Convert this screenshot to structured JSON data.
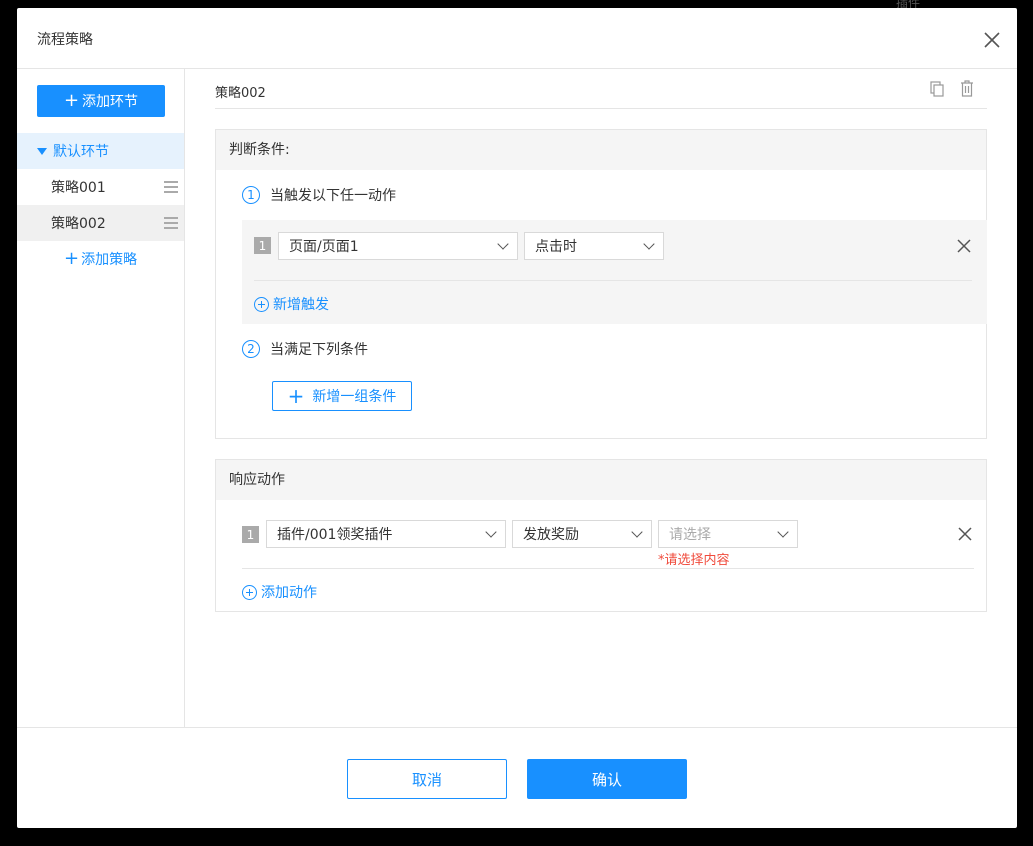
{
  "background_hint": "插件",
  "modal": {
    "title": "流程策略"
  },
  "sidebar": {
    "add_link_label": "添加环节",
    "group_label": "默认环节",
    "policies": [
      {
        "label": "策略001"
      },
      {
        "label": "策略002"
      }
    ],
    "add_policy_label": "添加策略"
  },
  "policy": {
    "name": "策略002"
  },
  "condition_panel": {
    "title": "判断条件:",
    "step1": {
      "num": "1",
      "label": "当触发以下任一动作"
    },
    "triggers": [
      {
        "index": "1",
        "page": "页面/页面1",
        "event": "点击时"
      }
    ],
    "add_trigger_label": "新增触发",
    "step2": {
      "num": "2",
      "label": "当满足下列条件"
    },
    "add_condition_group_label": "新增一组条件"
  },
  "response_panel": {
    "title": "响应动作",
    "actions": [
      {
        "index": "1",
        "plugin": "插件/001领奖插件",
        "action": "发放奖励",
        "content_placeholder": "请选择",
        "error": "*请选择内容"
      }
    ],
    "add_action_label": "添加动作"
  },
  "footer": {
    "cancel_label": "取消",
    "confirm_label": "确认"
  },
  "colors": {
    "accent": "#1890ff",
    "error": "#f04b3c"
  }
}
